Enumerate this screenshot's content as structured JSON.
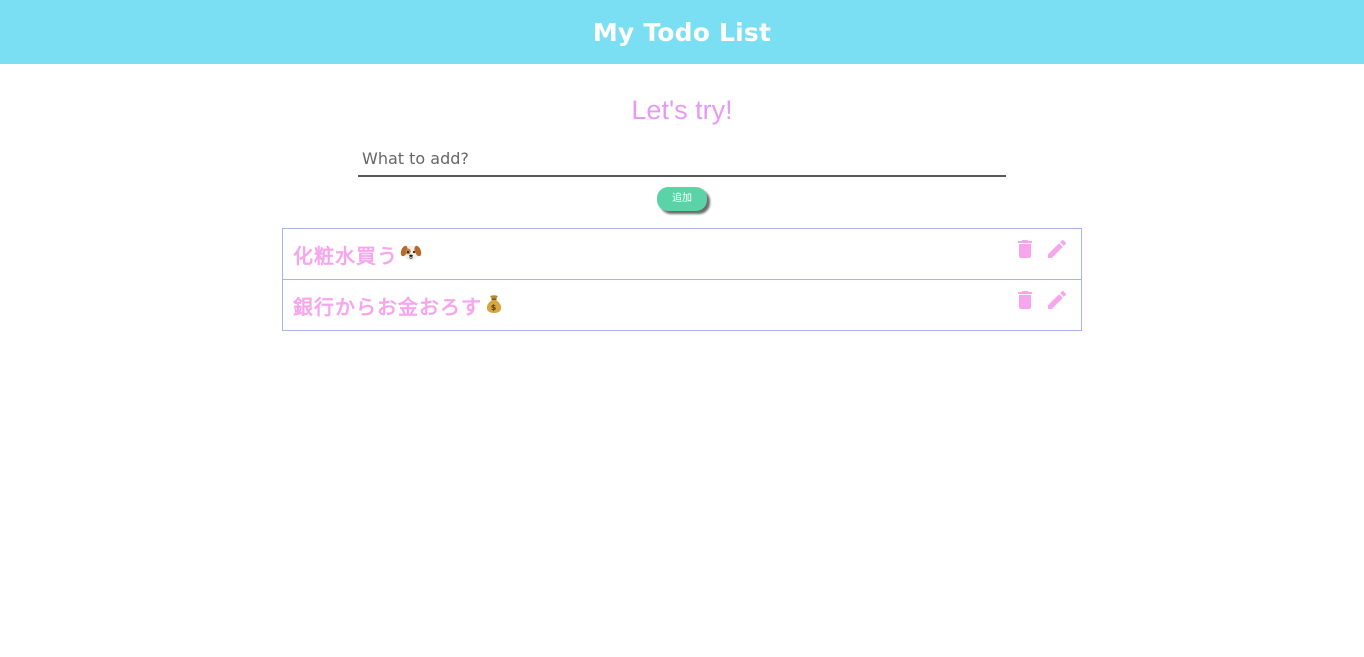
{
  "header": {
    "title": "My Todo List"
  },
  "main": {
    "subtitle": "Let's try!",
    "input": {
      "placeholder": "What to add?",
      "value": ""
    },
    "add_button_label": "追加"
  },
  "todos": [
    {
      "text": "化粧水買う",
      "emoji": "dog-face"
    },
    {
      "text": "銀行からお金おろす",
      "emoji": "money-bag"
    }
  ],
  "colors": {
    "header_bg": "#7adff3",
    "subtitle": "#e79af5",
    "todo_text": "#f7a6ee",
    "icon": "#f7a6ee",
    "item_border": "#a7b6ea",
    "button_bg": "#5ad3a6"
  },
  "icons": {
    "delete": "trash-icon",
    "edit": "pencil-icon"
  }
}
